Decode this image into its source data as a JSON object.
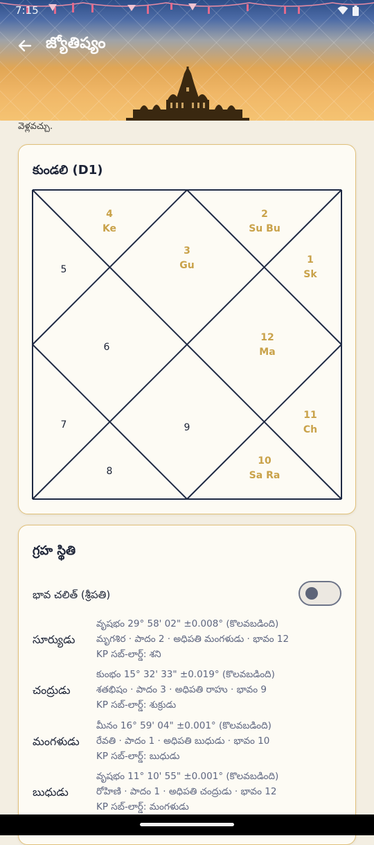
{
  "status_bar": {
    "time": "7:15"
  },
  "app_bar": {
    "title": "జ్యోతిష్యం",
    "back_icon": "arrow-left-icon"
  },
  "intro_tail": "వెళ్లవచ్చు.",
  "kundli": {
    "title": "కుండలి (D1)",
    "houses": [
      {
        "num": "4",
        "planets": "Ke"
      },
      {
        "num": "2",
        "planets": "Su Bu"
      },
      {
        "num": "3",
        "planets": "Gu"
      },
      {
        "num": "1",
        "planets": "Sk"
      },
      {
        "num": "5",
        "planets": ""
      },
      {
        "num": "6",
        "planets": ""
      },
      {
        "num": "12",
        "planets": "Ma"
      },
      {
        "num": "7",
        "planets": ""
      },
      {
        "num": "9",
        "planets": ""
      },
      {
        "num": "11",
        "planets": "Ch"
      },
      {
        "num": "8",
        "planets": ""
      },
      {
        "num": "10",
        "planets": "Sa Ra"
      }
    ],
    "colors": {
      "line": "#1f2a44",
      "planet_text": "#c9a24a",
      "plain_num": "#1c2336"
    }
  },
  "graha": {
    "title": "గ్రహ స్థితి",
    "toggle_label": "భావ చలిత్ (శ్రీపతి)",
    "toggle_on": false,
    "planets": [
      {
        "name": "సూర్యుడు",
        "line1": "వృషభం 29° 58' 02\"  ±0.008° (కొలవబడింది)",
        "line2": "మృగశిర · పాదం 2 · అధిపతి మంగళుడు · భావం 12",
        "line3": "KP సబ్-లార్డ్: శని"
      },
      {
        "name": "చంద్రుడు",
        "line1": "కుంభం 15° 32' 33\"  ±0.019° (కొలవబడింది)",
        "line2": "శతభిషం · పాదం 3 · అధిపతి రాహు · భావం 9",
        "line3": "KP సబ్-లార్డ్: శుక్రుడు"
      },
      {
        "name": "మంగళుడు",
        "line1": "మీనం 16° 59' 04\"  ±0.001° (కొలవబడింది)",
        "line2": "రేవతి · పాదం 1 · అధిపతి బుధుడు · భావం 10",
        "line3": "KP సబ్-లార్డ్: బుధుడు"
      },
      {
        "name": "బుధుడు",
        "line1": "వృషభం 11° 10' 55\"  ±0.001° (కొలవబడింది)",
        "line2": "రోహిణి · పాదం 1 · అధిపతి చంద్రుడు · భావం 12",
        "line3": "KP సబ్-లార్డ్: మంగళుడు"
      }
    ]
  }
}
